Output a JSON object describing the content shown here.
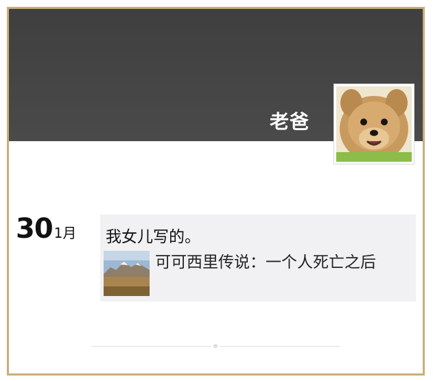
{
  "profile": {
    "name": "老爸"
  },
  "post": {
    "day": "30",
    "month": "1月",
    "text": "我女儿写的。",
    "link": {
      "title": "可可西里传说：一个人死亡之后"
    }
  },
  "colors": {
    "cover": "#444444",
    "frame_border": "#c9ad7c",
    "card_background": "#f1f1f3"
  }
}
